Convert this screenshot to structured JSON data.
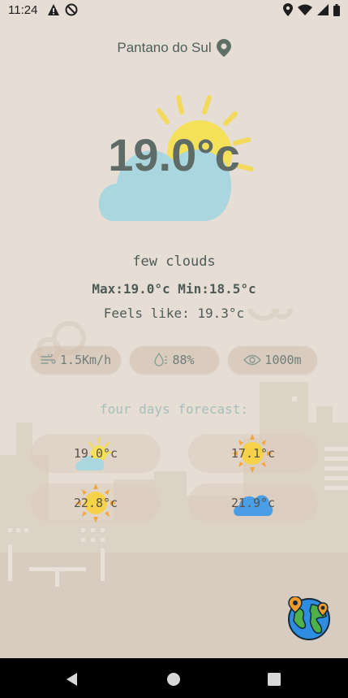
{
  "status": {
    "time": "11:24",
    "icons": [
      "alert-icon",
      "no-disturb-icon",
      "location-icon",
      "wifi-icon",
      "signal-icon",
      "battery-icon"
    ]
  },
  "location": {
    "name": "Pantano do Sul",
    "icon": "location-pin-icon"
  },
  "current": {
    "temperature": "19.0°c",
    "icon": "sun-cloud-icon",
    "description": "few clouds",
    "minmax": "Max:19.0°c Min:18.5°c",
    "feels_like": "Feels like: 19.3°c"
  },
  "stats": {
    "wind": "1.5Km/h",
    "humidity": "88%",
    "visibility": "1000m"
  },
  "forecast": {
    "title": "four days forecast:",
    "days": [
      {
        "temp": "19.0°c",
        "icon": "sun-cloud-icon"
      },
      {
        "temp": "17.1°c",
        "icon": "sun-icon"
      },
      {
        "temp": "22.8°c",
        "icon": "sun-icon"
      },
      {
        "temp": "21.9°c",
        "icon": "cloud-icon"
      }
    ]
  },
  "fab": {
    "icon": "globe-icon"
  },
  "colors": {
    "background": "#e6ddd4",
    "cloud": "#a9d6df",
    "sun": "#f5e05a",
    "sun_rays": "#f3d95c"
  }
}
